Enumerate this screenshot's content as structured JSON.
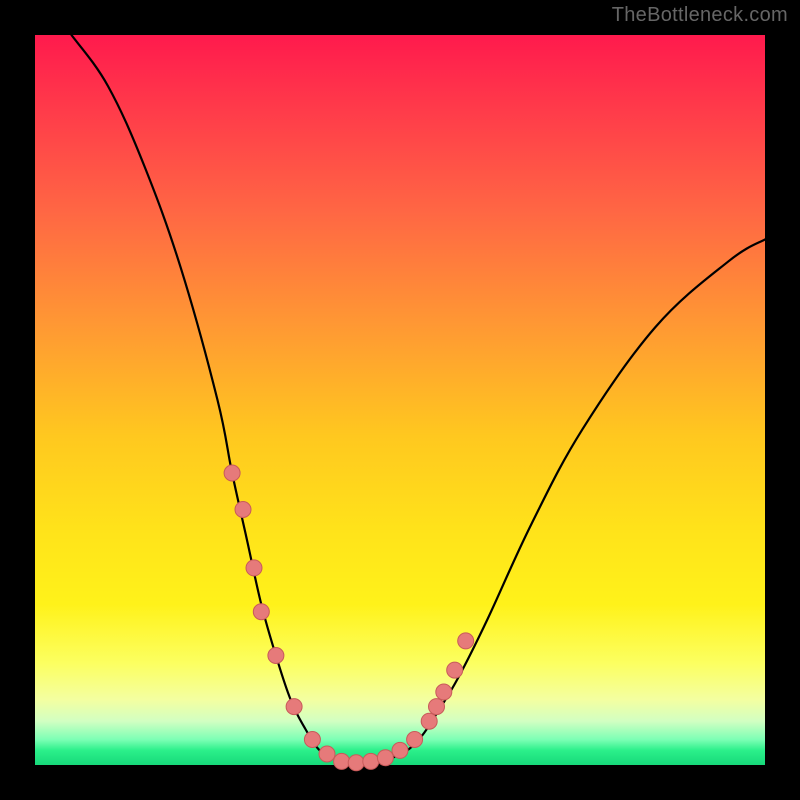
{
  "watermark": "TheBottleneck.com",
  "chart_data": {
    "type": "line",
    "title": "",
    "xlabel": "",
    "ylabel": "",
    "xlim": [
      0,
      100
    ],
    "ylim": [
      0,
      100
    ],
    "series": [
      {
        "name": "bottleneck-curve",
        "x": [
          5,
          10,
          15,
          20,
          25,
          27,
          29,
          31,
          33,
          35,
          37,
          39,
          41,
          43,
          45,
          47,
          49,
          51,
          53,
          55,
          58,
          62,
          68,
          75,
          85,
          95,
          100
        ],
        "y": [
          100,
          93,
          82,
          68,
          50,
          40,
          31,
          22,
          15,
          9,
          5,
          2,
          1,
          0,
          0,
          0,
          1,
          2,
          4,
          7,
          12,
          20,
          33,
          46,
          60,
          69,
          72
        ]
      }
    ],
    "markers": {
      "name": "highlighted-range-dots",
      "x": [
        27,
        28.5,
        30,
        31,
        33,
        35.5,
        38,
        40,
        42,
        44,
        46,
        48,
        50,
        52,
        54,
        55,
        56,
        57.5,
        59
      ],
      "y": [
        40,
        35,
        27,
        21,
        15,
        8,
        3.5,
        1.5,
        0.5,
        0.3,
        0.5,
        1,
        2,
        3.5,
        6,
        8,
        10,
        13,
        17
      ]
    },
    "background_gradient": {
      "top": "#ff1a4d",
      "mid_upper": "#ff9933",
      "mid": "#ffe31a",
      "mid_lower": "#fcff60",
      "bottom": "#17d97a"
    }
  }
}
